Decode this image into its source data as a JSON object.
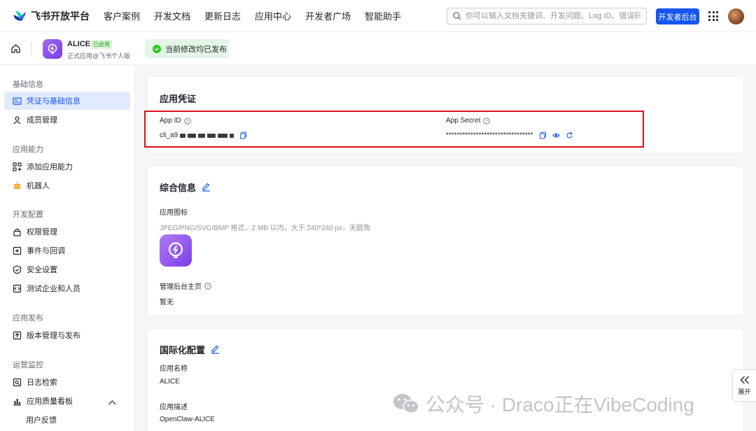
{
  "topnav": {
    "logo_text": "飞书开放平台",
    "items": [
      "客户案例",
      "开发文档",
      "更新日志",
      "应用中心",
      "开发者广场",
      "智能助手"
    ],
    "search_placeholder": "你可以输入文档关键词、开发问题、Log ID、错误码",
    "dev_console": "开发者后台"
  },
  "subheader": {
    "app_name": "ALICE",
    "app_badge": "已启用",
    "app_subtitle": "正式应用@飞书个人版",
    "publish_status": "当前修改均已发布"
  },
  "sidebar": {
    "groups": [
      {
        "title": "基础信息",
        "items": [
          "凭证与基础信息",
          "成员管理"
        ]
      },
      {
        "title": "应用能力",
        "items": [
          "添加应用能力",
          "机器人"
        ]
      },
      {
        "title": "开发配置",
        "items": [
          "权限管理",
          "事件与回调",
          "安全设置",
          "测试企业和人员"
        ]
      },
      {
        "title": "应用发布",
        "items": [
          "版本管理与发布"
        ]
      },
      {
        "title": "运营监控",
        "items": [
          "日志检索",
          "应用质量看板",
          "用户反馈"
        ]
      }
    ]
  },
  "credentials": {
    "title": "应用凭证",
    "app_id_label": "App ID",
    "app_id_prefix": "cli_a9",
    "app_secret_label": "App Secret",
    "app_secret_masked": "********************************"
  },
  "general": {
    "title": "综合信息",
    "icon_label": "应用图标",
    "icon_hint": "JPEG/PNG/SVG/BMP 格式，2 MB 以内，大于 240*240 px，无圆角",
    "homepage_label": "管理后台主页",
    "homepage_value": "暂无"
  },
  "i18n": {
    "title": "国际化配置",
    "name_label": "应用名称",
    "name_value": "ALICE",
    "desc_label": "应用描述",
    "desc_value": "OpenClaw-ALICE"
  },
  "expand_label": "展开",
  "watermark": "公众号 · Draco正在VibeCoding",
  "colors": {
    "primary": "#1456f0",
    "highlight": "#d8101e",
    "success": "#34c724"
  }
}
